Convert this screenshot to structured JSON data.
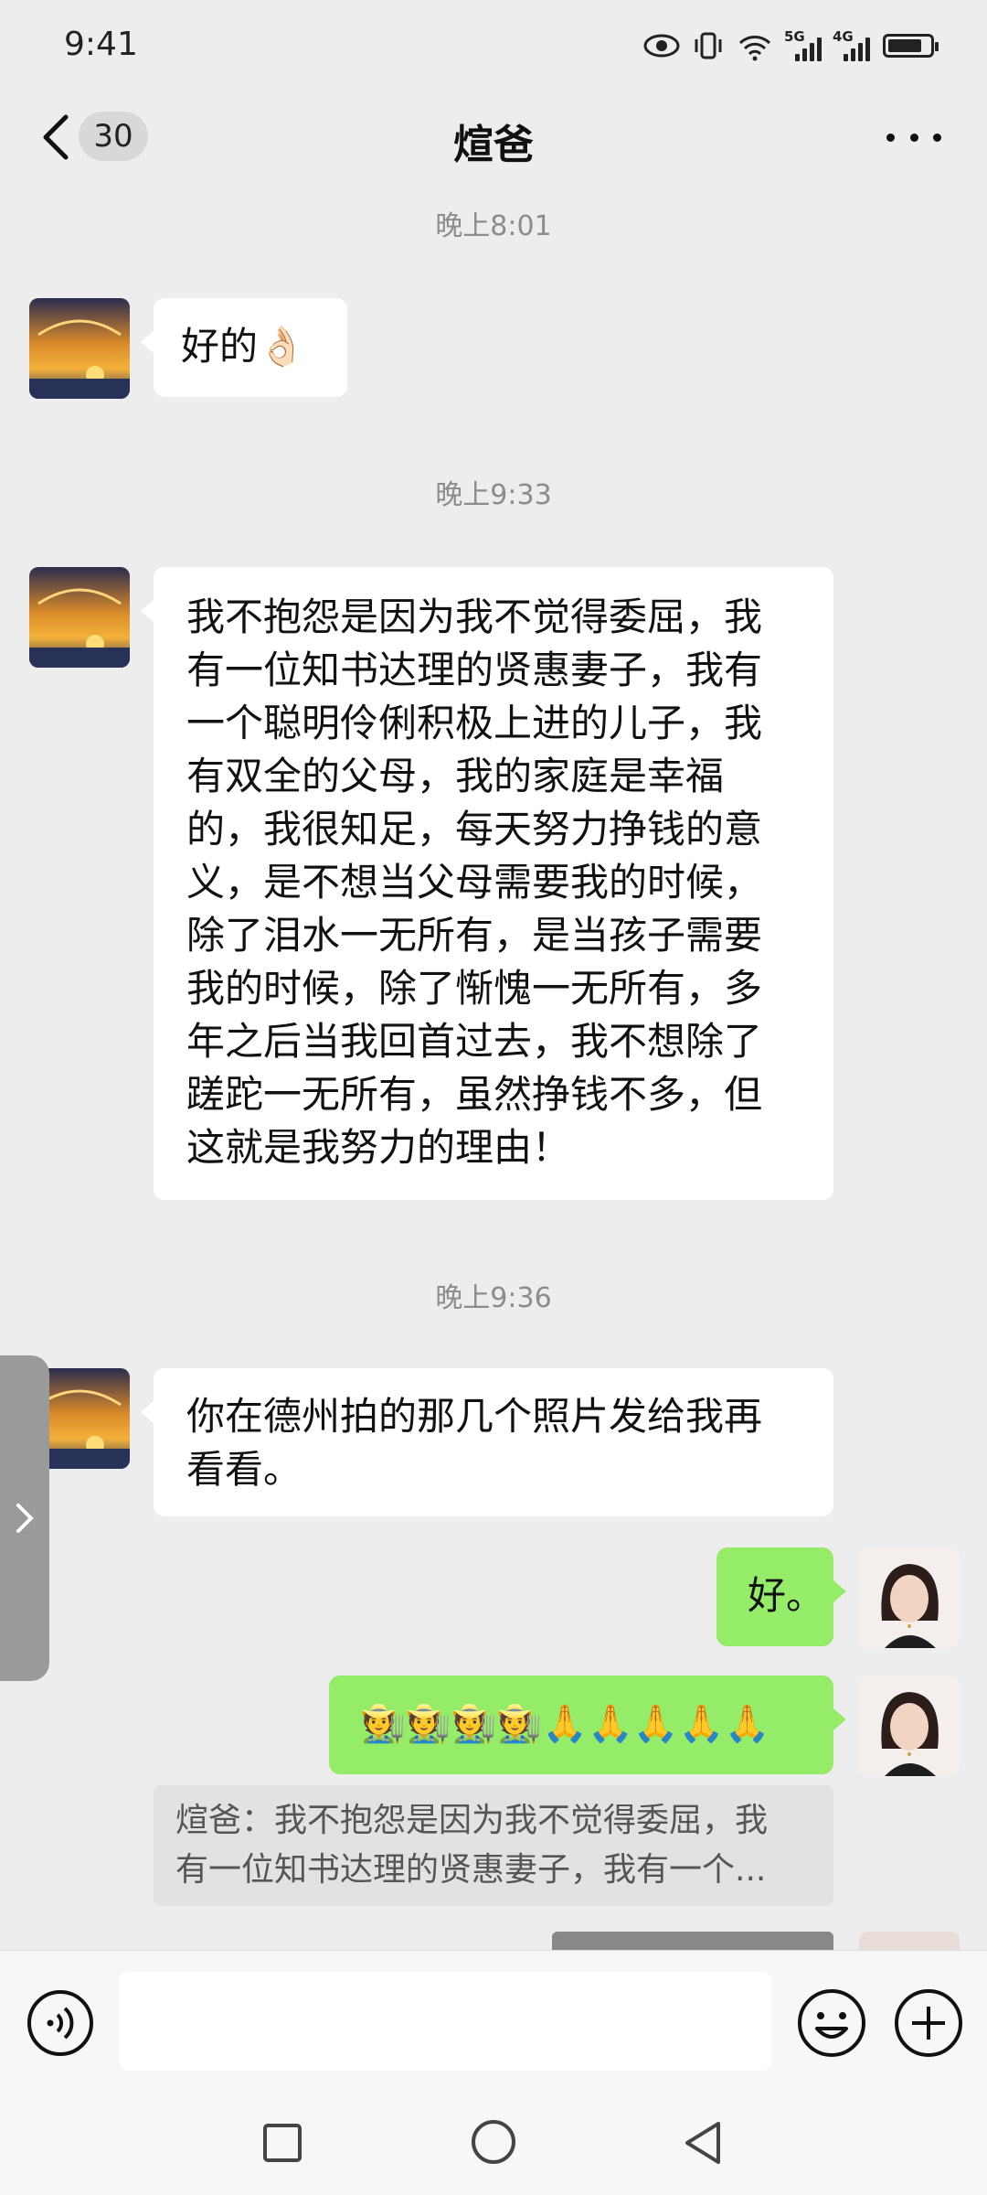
{
  "status_bar": {
    "time": "9:41",
    "signal_1": "5G",
    "signal_2": "4G"
  },
  "header": {
    "title": "煊爸",
    "unread_count": "30"
  },
  "messages": [
    {
      "time": "晚上8:01",
      "sender": "contact",
      "text": "好的👌🏻"
    },
    {
      "time": "晚上9:33",
      "sender": "contact",
      "lines": [
        "我不抱怨是因为我不觉得委屈，我",
        "有一位知书达理的贤惠妻子，我有",
        "一个聪明伶俐积极上进的儿子，我",
        "有双全的父母，我的家庭是幸福",
        "的，我很知足，每天努力挣钱的意",
        "义，是不想当父母需要我的时候，",
        "除了泪水一无所有，是当孩子需要",
        "我的时候，除了惭愧一无所有，多",
        "年之后当我回首过去，我不想除了",
        "蹉跎一无所有，虽然挣钱不多，但",
        "这就是我努力的理由！"
      ]
    },
    {
      "time": "晚上9:36",
      "sender": "contact",
      "lines": [
        "你在德州拍的那几个照片发给我再",
        "看看。"
      ]
    },
    {
      "sender": "me",
      "text": "好。"
    },
    {
      "sender": "me",
      "text": "🧑‍🌾🧑‍🌾🧑‍🌾🧑‍🌾🙏🙏🙏🙏🙏"
    }
  ],
  "quote": {
    "lines": [
      "煊爸：我不抱怨是因为我不觉得委屈，我",
      "有一位知书达理的贤惠妻子，我有一个..."
    ]
  },
  "input": {
    "placeholder": ""
  },
  "colors": {
    "background": "#ededed",
    "my_bubble": "#95ec69",
    "their_bubble": "#ffffff",
    "timestamp": "#8c8c8c"
  },
  "icons": {
    "back": "chevron-left-icon",
    "more": "more-dots-icon",
    "voice": "voice-icon",
    "emoji": "emoji-icon",
    "plus": "plus-icon"
  }
}
